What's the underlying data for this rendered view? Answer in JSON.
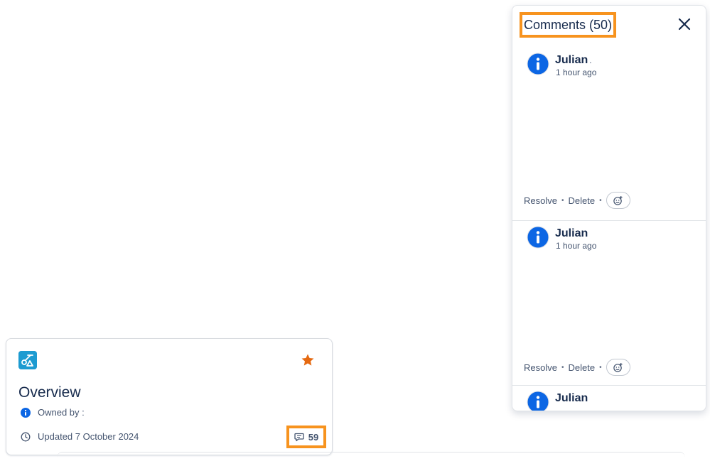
{
  "card": {
    "title": "Overview",
    "owned_by": "Owned by",
    "owner": ":",
    "updated": "Updated 7 October 2024",
    "comment_count": "59"
  },
  "panel": {
    "title": "Comments (50)",
    "comments": [
      {
        "author": "Julian",
        "suffix": ".",
        "time": "1 hour ago",
        "resolve": "Resolve",
        "delete": "Delete"
      },
      {
        "author": "Julian",
        "suffix": "",
        "time": "1 hour ago",
        "resolve": "Resolve",
        "delete": "Delete"
      },
      {
        "author": "Julian"
      }
    ]
  },
  "colors": {
    "highlight": "#f7931e",
    "avatar": "#0c66e4",
    "star": "#e56910",
    "space_icon": "#1d9bd1"
  },
  "icons": [
    "space-icon",
    "star-icon",
    "info-icon",
    "clock-icon",
    "comment-icon",
    "close-icon",
    "add-reaction-icon"
  ]
}
